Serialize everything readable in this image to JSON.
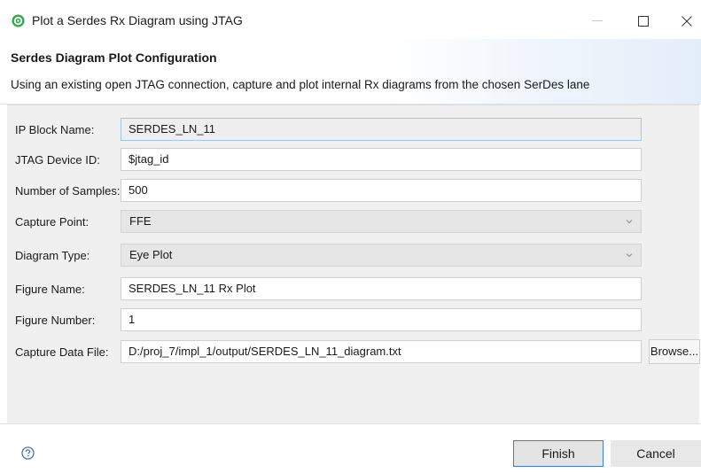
{
  "window": {
    "title": "Plot a Serdes Rx Diagram using JTAG",
    "icon": "green-circle-app-icon"
  },
  "banner": {
    "title": "Serdes Diagram Plot Configuration",
    "description": "Using an existing open JTAG connection, capture and plot internal Rx diagrams from the chosen SerDes lane"
  },
  "form": {
    "ip_block": {
      "label": "IP Block Name:",
      "value": "SERDES_LN_11"
    },
    "jtag_id": {
      "label": "JTAG Device ID:",
      "value": "$jtag_id"
    },
    "samples": {
      "label": "Number of Samples:",
      "value": "500"
    },
    "capture_point": {
      "label": "Capture Point:",
      "value": "FFE"
    },
    "diagram_type": {
      "label": "Diagram Type:",
      "value": "Eye Plot"
    },
    "figure_name": {
      "label": "Figure Name:",
      "value": "SERDES_LN_11 Rx Plot"
    },
    "figure_number": {
      "label": "Figure Number:",
      "value": "1"
    },
    "capture_file": {
      "label": "Capture Data File:",
      "value": "D:/proj_7/impl_1/output/SERDES_LN_11_diagram.txt",
      "browse_label": "Browse..."
    }
  },
  "footer": {
    "finish_label": "Finish",
    "cancel_label": "Cancel"
  },
  "colors": {
    "accent_border": "#3b7bd4",
    "readonly_border": "#a9c3e6",
    "app_icon_green": "#2eaa4a"
  }
}
